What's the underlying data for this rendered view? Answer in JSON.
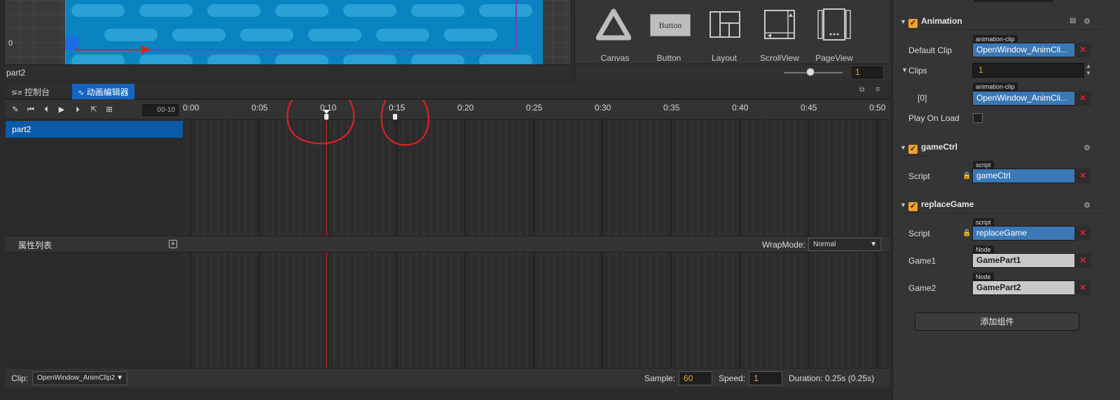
{
  "scene": {
    "axis_zero": "0",
    "node_name": "part2"
  },
  "widgets": {
    "items": [
      {
        "label": "Canvas",
        "icon": "canvas-icon"
      },
      {
        "label": "Button",
        "icon": "button-icon",
        "icon_text": "Button"
      },
      {
        "label": "Layout",
        "icon": "layout-icon"
      },
      {
        "label": "ScrollView",
        "icon": "scrollview-icon"
      },
      {
        "label": "PageView",
        "icon": "pageview-icon"
      }
    ],
    "zoom_value": "1"
  },
  "anim_editor": {
    "tabs": [
      {
        "label": "控制台",
        "icon": "console-icon"
      },
      {
        "label": "动画编辑器",
        "icon": "animation-icon"
      }
    ],
    "frame_display": "00-10",
    "nodes": [
      "part2"
    ],
    "ticks": [
      "0:00",
      "0:05",
      "0:10",
      "0:15",
      "0:20",
      "0:25",
      "0:30",
      "0:35",
      "0:40",
      "0:45",
      "0:50"
    ],
    "property_list_title": "属性列表",
    "wrapmode_label": "WrapMode:",
    "wrapmode_value": "Normal",
    "footer": {
      "clip_label": "Clip:",
      "clip_value": "OpenWindow_AnimClip2",
      "sample_label": "Sample:",
      "sample_value": "60",
      "speed_label": "Speed:",
      "speed_value": "1",
      "duration": "Duration: 0.25s (0.25s)"
    }
  },
  "inspector": {
    "animation": {
      "title": "Animation",
      "default_clip_label": "Default Clip",
      "default_clip_tag": "animation-clip",
      "default_clip_value": "OpenWindow_AnimCli...",
      "clips_label": "Clips",
      "clips_count": "1",
      "clip0_label": "[0]",
      "clip0_tag": "animation-clip",
      "clip0_value": "OpenWindow_AnimCli...",
      "play_on_load_label": "Play On Load"
    },
    "gamectrl": {
      "title": "gameCtrl",
      "script_label": "Script",
      "script_tag": "script",
      "script_value": "gameCtrl"
    },
    "replacegame": {
      "title": "replaceGame",
      "script_label": "Script",
      "script_tag": "script",
      "script_value": "replaceGame",
      "game1_label": "Game1",
      "game1_tag": "Node",
      "game1_value": "GamePart1",
      "game2_label": "Game2",
      "game2_tag": "Node",
      "game2_value": "GamePart2"
    },
    "add_component": "添加组件"
  },
  "colors": {
    "accent_blue": "#1565c0",
    "playhead_red": "#e02020",
    "checkbox_orange": "#f0a030",
    "annotation_red": "#e02020"
  }
}
